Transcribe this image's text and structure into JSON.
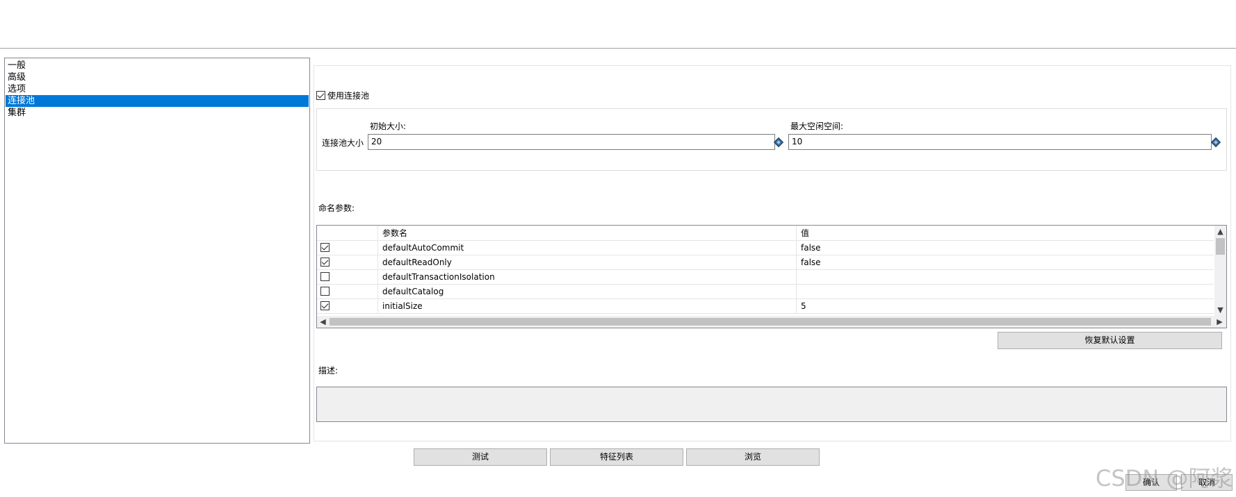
{
  "nav": {
    "items": [
      {
        "label": "一般"
      },
      {
        "label": "高级"
      },
      {
        "label": "选项"
      },
      {
        "label": "连接池",
        "selected": true
      },
      {
        "label": "集群"
      }
    ]
  },
  "pool": {
    "use_pool_label": "使用连接池",
    "use_pool_checked": true,
    "size_label": "连接池大小",
    "initial_size_caption": "初始大小:",
    "initial_size_value": "20",
    "max_idle_caption": "最大空闲空间:",
    "max_idle_value": "10"
  },
  "params": {
    "section_label": "命名参数:",
    "columns": [
      "参数名",
      "值"
    ],
    "rows": [
      {
        "checked": true,
        "name": "defaultAutoCommit",
        "value": "false"
      },
      {
        "checked": true,
        "name": "defaultReadOnly",
        "value": "false"
      },
      {
        "checked": false,
        "name": "defaultTransactionIsolation",
        "value": ""
      },
      {
        "checked": false,
        "name": "defaultCatalog",
        "value": ""
      },
      {
        "checked": true,
        "name": "initialSize",
        "value": "5"
      }
    ],
    "restore_defaults_label": "恢复默认设置"
  },
  "description": {
    "label": "描述:",
    "text": ""
  },
  "buttons": {
    "test": "测试",
    "feature_list": "特征列表",
    "browse": "浏览",
    "ok": "确认",
    "cancel": "取消"
  },
  "icons": {
    "spin": "variable-diamond-icon",
    "check": "checkmark-icon"
  },
  "watermark": "CSDN @阿浆"
}
